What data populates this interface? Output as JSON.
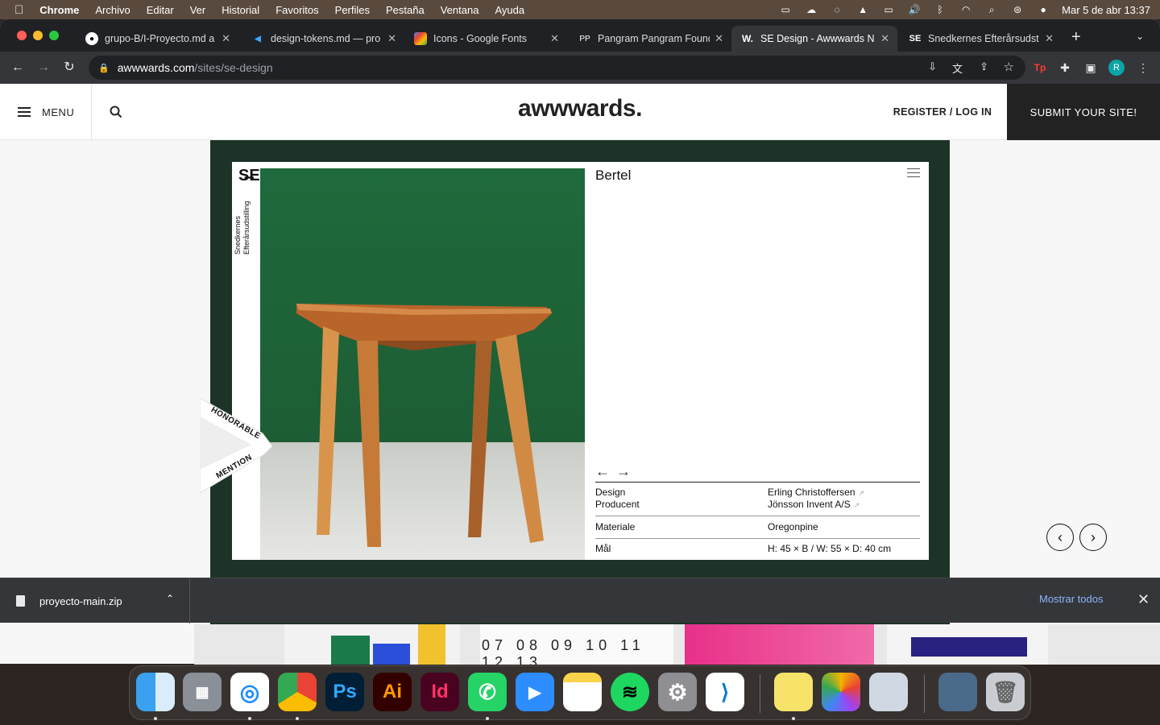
{
  "menubar": {
    "apple": "",
    "items": [
      "Chrome",
      "Archivo",
      "Editar",
      "Ver",
      "Historial",
      "Favoritos",
      "Perfiles",
      "Pestaña",
      "Ventana",
      "Ayuda"
    ],
    "clock": "Mar 5 de abr  13:37"
  },
  "tabs": [
    {
      "label": "grupo-B/I-Proyecto.md a",
      "favicon": "github-icon"
    },
    {
      "label": "design-tokens.md — pro",
      "favicon": "vscode-icon"
    },
    {
      "label": "Icons - Google Fonts",
      "favicon": "google-fonts-icon"
    },
    {
      "label": "Pangram Pangram Found",
      "favicon": "PP"
    },
    {
      "label": "SE Design - Awwwards N",
      "favicon": "W."
    },
    {
      "label": "Snedkernes Efterårsudst",
      "favicon": "SE"
    }
  ],
  "address": {
    "host": "awwwards.com",
    "path": "/sites/se-design"
  },
  "avatar_letter": "R",
  "site": {
    "menu_label": "MENU",
    "logo": "awwwards.",
    "login": "REGISTER / LOG IN",
    "submit": "SUBMIT YOUR SITE!"
  },
  "showcase": {
    "se_logo": "S̶E",
    "vertical_text": "Snedkernes Efterårsudstilling",
    "product_title": "Bertel",
    "badge_line1": "HONORABLE",
    "badge_line2": "MENTION",
    "specs": [
      {
        "label": "Design",
        "value": "Erling Christoffersen"
      },
      {
        "label": "Producent",
        "value": "Jönsson Invent A/S"
      },
      {
        "label": "Materiale",
        "value": "Oregonpine"
      },
      {
        "label": "Mål",
        "value": "H: 45 × B / W: 55 × D: 40 cm"
      }
    ]
  },
  "download": {
    "filename": "proyecto-main.zip",
    "show_all": "Mostrar todos"
  },
  "dock": [
    "Finder",
    "Launchpad",
    "Safari",
    "Chrome",
    "Ps",
    "Ai",
    "Id",
    "WhatsApp",
    "Zoom",
    "Notes",
    "Spotify",
    "System Preferences",
    "VS Code",
    "Stickies",
    "Photos",
    "Preview",
    "Downloads",
    "Trash"
  ],
  "colors": {
    "stage_green": "#1d3327",
    "accent_blue": "#8ab4f8"
  }
}
